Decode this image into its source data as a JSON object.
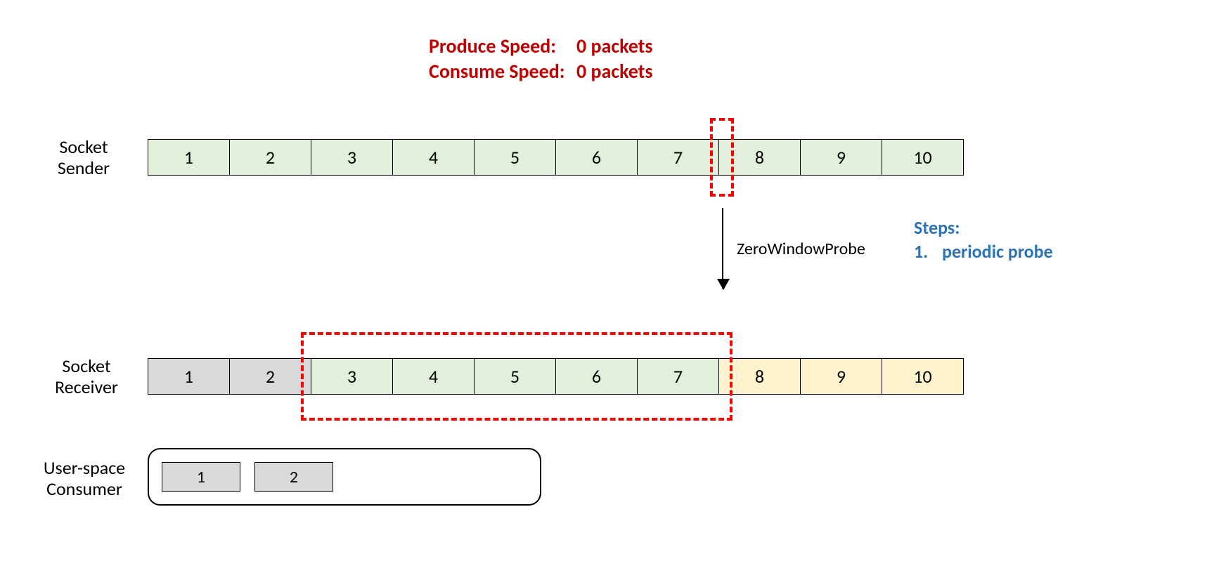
{
  "speed": {
    "produce_label": "Produce Speed:",
    "produce_value": "0 packets",
    "consume_label": "Consume Speed:",
    "consume_value": "0 packets"
  },
  "labels": {
    "sender_l1": "Socket",
    "sender_l2": "Sender",
    "receiver_l1": "Socket",
    "receiver_l2": "Receiver",
    "consumer_l1": "User-space",
    "consumer_l2": "Consumer"
  },
  "sender_cells": [
    "1",
    "2",
    "3",
    "4",
    "5",
    "6",
    "7",
    "8",
    "9",
    "10"
  ],
  "receiver_cells": [
    "1",
    "2",
    "3",
    "4",
    "5",
    "6",
    "7",
    "8",
    "9",
    "10"
  ],
  "consumer_cells": [
    "1",
    "2"
  ],
  "probe_label": "ZeroWindowProbe",
  "steps": {
    "title": "Steps:",
    "item1_num": "1.",
    "item1_text": "periodic probe"
  },
  "chart_data": {
    "type": "table",
    "title": "TCP Zero Window Probe — buffer state",
    "produce_speed_packets": 0,
    "consume_speed_packets": 0,
    "sender_buffer": {
      "cells": [
        1,
        2,
        3,
        4,
        5,
        6,
        7,
        8,
        9,
        10
      ],
      "all_available_green": true,
      "send_window_boundary_after_cell": 7,
      "send_window_size_cells": 0
    },
    "receiver_buffer": {
      "cells": [
        1,
        2,
        3,
        4,
        5,
        6,
        7,
        8,
        9,
        10
      ],
      "consumed_grey": [
        1,
        2
      ],
      "received_green": [
        3,
        4,
        5,
        6,
        7
      ],
      "free_yellow": [
        8,
        9,
        10
      ],
      "advertised_window_cells": [
        3,
        4,
        5,
        6,
        7
      ]
    },
    "user_space_consumer": {
      "consumed": [
        1,
        2
      ]
    },
    "arrow": {
      "from": "sender cell boundary after 7",
      "to": "receiver",
      "label": "ZeroWindowProbe"
    },
    "steps": [
      "periodic probe"
    ]
  }
}
